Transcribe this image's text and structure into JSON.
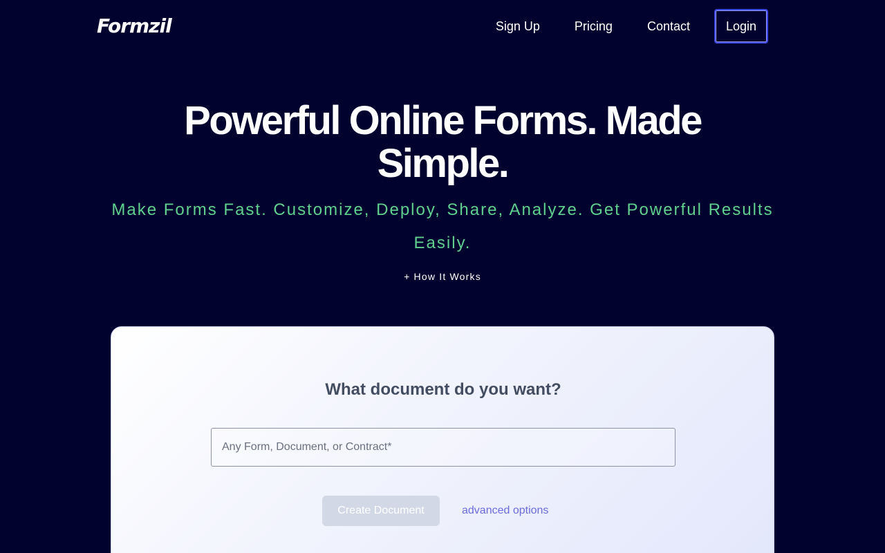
{
  "header": {
    "logo_text": "Formzil",
    "nav": {
      "sign_up": "Sign Up",
      "pricing": "Pricing",
      "contact": "Contact",
      "login": "Login"
    }
  },
  "hero": {
    "title": "Powerful Online Forms. Made Simple.",
    "subtitle": "Make Forms Fast. Customize, Deploy, Share, Analyze. Get Powerful Results Easily.",
    "how_it_works": "+ How It Works"
  },
  "card": {
    "title": "What document do you want?",
    "input_placeholder": "Any Form, Document, or Contract*",
    "input_value": "",
    "create_button": "Create Document",
    "advanced_link": "advanced options"
  },
  "colors": {
    "background": "#02022e",
    "accent_green": "#5fd08f",
    "login_border": "#3b47e6",
    "link_purple": "#6a6cdc",
    "button_disabled": "#d3d8e6"
  }
}
